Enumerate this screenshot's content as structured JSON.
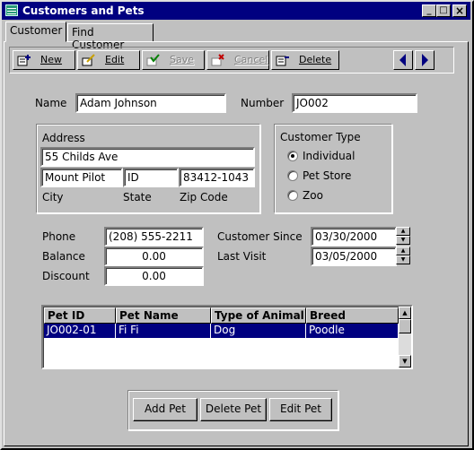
{
  "window": {
    "title": "Customers and Pets",
    "min": "_",
    "max": "□",
    "close": "×"
  },
  "tabs": [
    {
      "label": "Customer"
    },
    {
      "label": "Find Customer"
    }
  ],
  "toolbar": {
    "new": "New",
    "edit": "Edit",
    "save": "Save",
    "cancel": "Cancel",
    "delete": "Delete",
    "prev": "◄",
    "next": "►"
  },
  "customer": {
    "name_label": "Name",
    "name": "Adam Johnson",
    "number_label": "Number",
    "number": "JO002",
    "address_label": "Address",
    "street": "55 Childs Ave",
    "city": "Mount Pilot",
    "state": "ID",
    "zip": "83412-1043",
    "city_label": "City",
    "state_label": "State",
    "zip_label": "Zip Code",
    "type_label": "Customer Type",
    "types": [
      "Individual",
      "Pet Store",
      "Zoo"
    ],
    "selected_type": "Individual",
    "phone_label": "Phone",
    "phone": "(208)  555-2211",
    "balance_label": "Balance",
    "balance": "0.00",
    "discount_label": "Discount",
    "discount": "0.00",
    "since_label": "Customer Since",
    "since": "03/30/2000",
    "visit_label": "Last Visit",
    "visit": "03/05/2000"
  },
  "pets": {
    "columns": [
      "Pet ID",
      "Pet Name",
      "Type of Animal",
      "Breed"
    ],
    "rows": [
      [
        "JO002-01",
        "Fi Fi",
        "Dog",
        "Poodle"
      ]
    ]
  },
  "buttons": {
    "add": "Add Pet",
    "delete": "Delete Pet",
    "edit": "Edit Pet"
  },
  "colors": {
    "titlebar": "#000080",
    "face": "#c0c0c0",
    "selection": "#000080"
  }
}
